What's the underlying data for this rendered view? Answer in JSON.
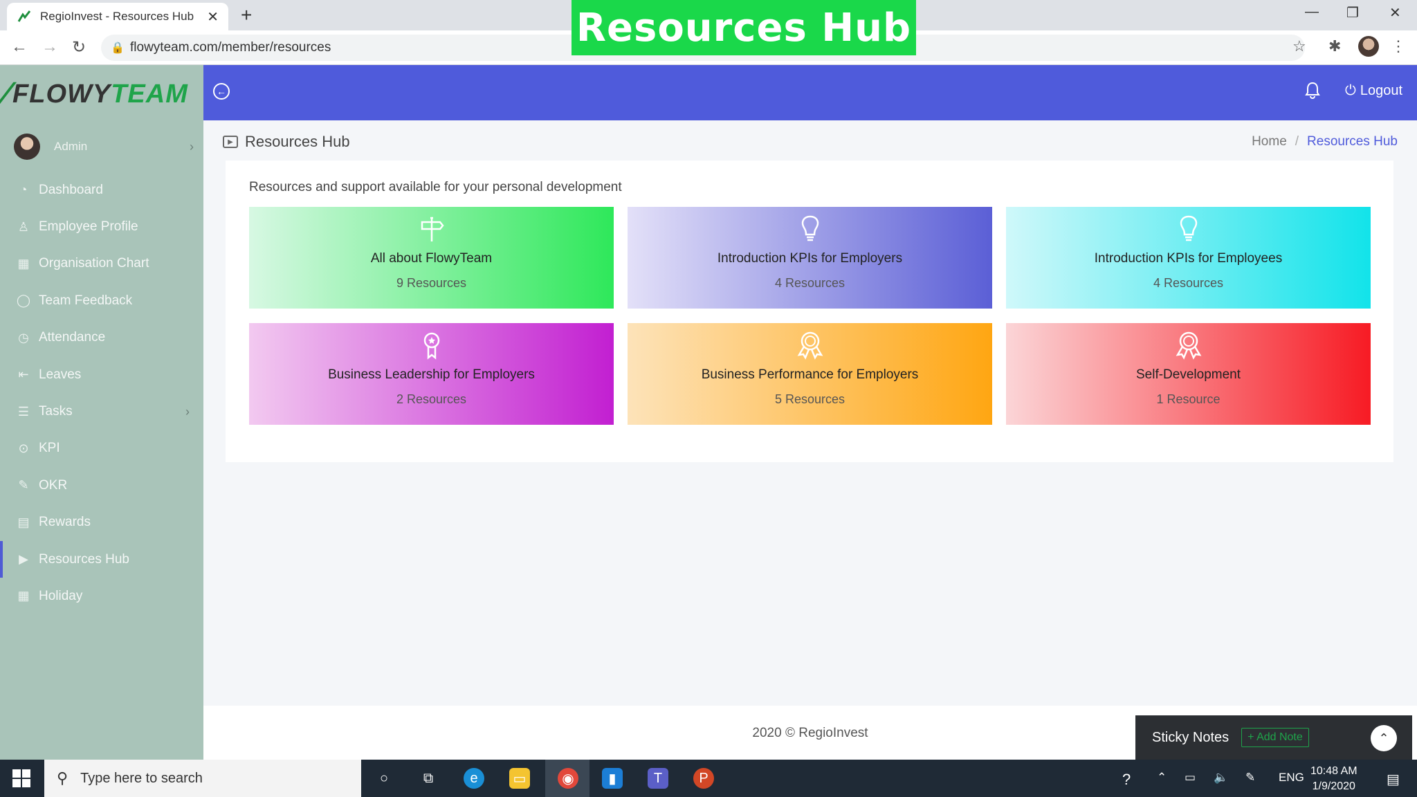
{
  "browser": {
    "tab_title": "RegioInvest - Resources Hub",
    "url": "flowyteam.com/member/resources"
  },
  "overlay_title": "Resources Hub",
  "brand": {
    "flowy": "FLOWY",
    "team": "TEAM"
  },
  "user": {
    "name": "Admin"
  },
  "sidebar": {
    "items": [
      {
        "label": "Dashboard",
        "icon": "gauge-icon"
      },
      {
        "label": "Employee Profile",
        "icon": "user-icon"
      },
      {
        "label": "Organisation Chart",
        "icon": "org-chart-icon"
      },
      {
        "label": "Team Feedback",
        "icon": "chat-icon"
      },
      {
        "label": "Attendance",
        "icon": "clock-icon"
      },
      {
        "label": "Leaves",
        "icon": "logout-icon"
      },
      {
        "label": "Tasks",
        "icon": "list-icon"
      },
      {
        "label": "KPI",
        "icon": "target-icon"
      },
      {
        "label": "OKR",
        "icon": "pen-icon"
      },
      {
        "label": "Rewards",
        "icon": "gift-icon"
      },
      {
        "label": "Resources Hub",
        "icon": "video-icon"
      },
      {
        "label": "Holiday",
        "icon": "calendar-icon"
      }
    ]
  },
  "navbar": {
    "logout_label": "Logout"
  },
  "page": {
    "title": "Resources Hub",
    "breadcrumb": {
      "home": "Home",
      "current": "Resources Hub"
    },
    "subtitle": "Resources and support available for your personal development"
  },
  "resources": [
    {
      "name": "All about FlowyTeam",
      "count": "9 Resources",
      "icon": "signpost-icon",
      "colors": [
        "#d7f8e3",
        "#2ee85a"
      ]
    },
    {
      "name": "Introduction KPIs for Employers",
      "count": "4 Resources",
      "icon": "lightbulb-icon",
      "colors": [
        "#e3e0f8",
        "#5b5fd6"
      ]
    },
    {
      "name": "Introduction KPIs for Employees",
      "count": "4 Resources",
      "icon": "lightbulb-icon",
      "colors": [
        "#cff8fa",
        "#12e3ea"
      ]
    },
    {
      "name": "Business Leadership for Employers",
      "count": "2 Resources",
      "icon": "medal-icon",
      "colors": [
        "#f2c9f0",
        "#c21fd1"
      ]
    },
    {
      "name": "Business Performance for Employers",
      "count": "5 Resources",
      "icon": "award-icon",
      "colors": [
        "#fde3b9",
        "#ffa612"
      ]
    },
    {
      "name": "Self-Development",
      "count": "1 Resource",
      "icon": "award-icon",
      "colors": [
        "#fbd5d7",
        "#f71b24"
      ]
    }
  ],
  "footer": {
    "copyright": "2020 © RegioInvest"
  },
  "sticky_notes": {
    "label": "Sticky Notes",
    "add_label": "+ Add Note"
  },
  "taskbar": {
    "search_placeholder": "Type here to search",
    "lang": "ENG",
    "time": "10:48 AM",
    "date": "1/9/2020"
  }
}
